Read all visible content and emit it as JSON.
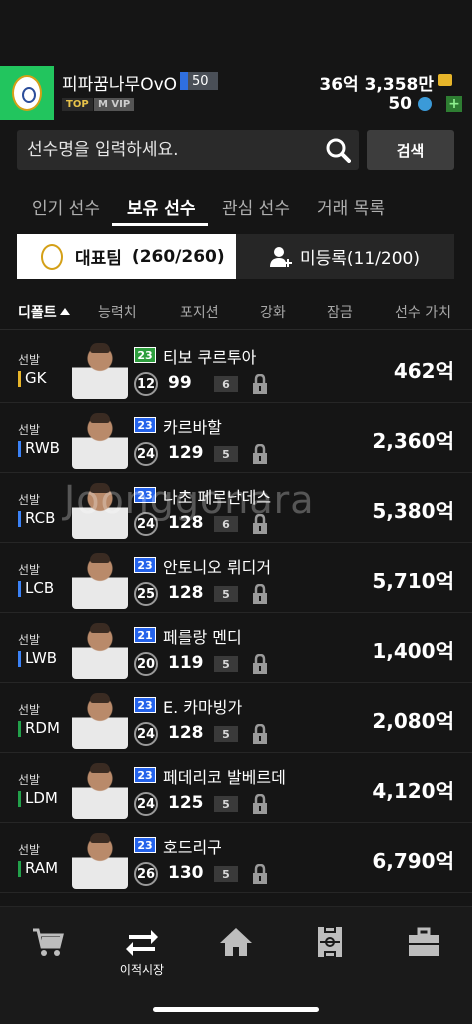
{
  "profile": {
    "nickname": "피파꿈나무OvO",
    "level": "50",
    "tag_top": "TOP",
    "tag_vip": "M VIP",
    "money": "36억 3,358만",
    "points": "50",
    "plus": "+"
  },
  "search": {
    "placeholder": "선수명을 입력하세요.",
    "button": "검색"
  },
  "tabs": [
    "인기 선수",
    "보유 선수",
    "관심 선수",
    "거래 목록"
  ],
  "segment": {
    "team_label": "대표팀",
    "team_count": "(260/260)",
    "unregistered": "미등록(11/200)"
  },
  "sort_columns": [
    "디폴트",
    "능력치",
    "포지션",
    "강화",
    "잠금",
    "선수 가치"
  ],
  "players": [
    {
      "status": "선발",
      "pos": "GK",
      "pos_color": "#e7b52a",
      "season": "23",
      "season_color": "#2e9e3e",
      "name": "티보 쿠르투아",
      "grade": "12",
      "ovr": "99",
      "enhance": "6",
      "price": "462억"
    },
    {
      "status": "선발",
      "pos": "RWB",
      "pos_color": "#3b82f6",
      "season": "23",
      "season_color": "#2563eb",
      "name": "카르바할",
      "grade": "24",
      "ovr": "129",
      "enhance": "5",
      "price": "2,360억"
    },
    {
      "status": "선발",
      "pos": "RCB",
      "pos_color": "#3b82f6",
      "season": "23",
      "season_color": "#2563eb",
      "name": "나초 페르난데스",
      "grade": "24",
      "ovr": "128",
      "enhance": "6",
      "price": "5,380억"
    },
    {
      "status": "선발",
      "pos": "LCB",
      "pos_color": "#3b82f6",
      "season": "23",
      "season_color": "#2563eb",
      "name": "안토니오 뤼디거",
      "grade": "25",
      "ovr": "128",
      "enhance": "5",
      "price": "5,710억"
    },
    {
      "status": "선발",
      "pos": "LWB",
      "pos_color": "#3b82f6",
      "season": "21",
      "season_color": "#2563eb",
      "name": "페를랑 멘디",
      "grade": "20",
      "ovr": "119",
      "enhance": "5",
      "price": "1,400억"
    },
    {
      "status": "선발",
      "pos": "RDM",
      "pos_color": "#22a04a",
      "season": "23",
      "season_color": "#2563eb",
      "name": "E. 카마빙가",
      "grade": "24",
      "ovr": "128",
      "enhance": "5",
      "price": "2,080억"
    },
    {
      "status": "선발",
      "pos": "LDM",
      "pos_color": "#22a04a",
      "season": "23",
      "season_color": "#2563eb",
      "name": "페데리코 발베르데",
      "grade": "24",
      "ovr": "125",
      "enhance": "5",
      "price": "4,120억"
    },
    {
      "status": "선발",
      "pos": "RAM",
      "pos_color": "#22a04a",
      "season": "23",
      "season_color": "#2563eb",
      "name": "호드리구",
      "grade": "26",
      "ovr": "130",
      "enhance": "5",
      "price": "6,790억"
    }
  ],
  "watermark": "Joonggonara",
  "bottom_nav": {
    "items": [
      {
        "icon": "cart-icon",
        "label": ""
      },
      {
        "icon": "transfer-icon",
        "label": "이적시장"
      },
      {
        "icon": "home-icon",
        "label": ""
      },
      {
        "icon": "pitch-icon",
        "label": ""
      },
      {
        "icon": "briefcase-icon",
        "label": ""
      }
    ]
  }
}
